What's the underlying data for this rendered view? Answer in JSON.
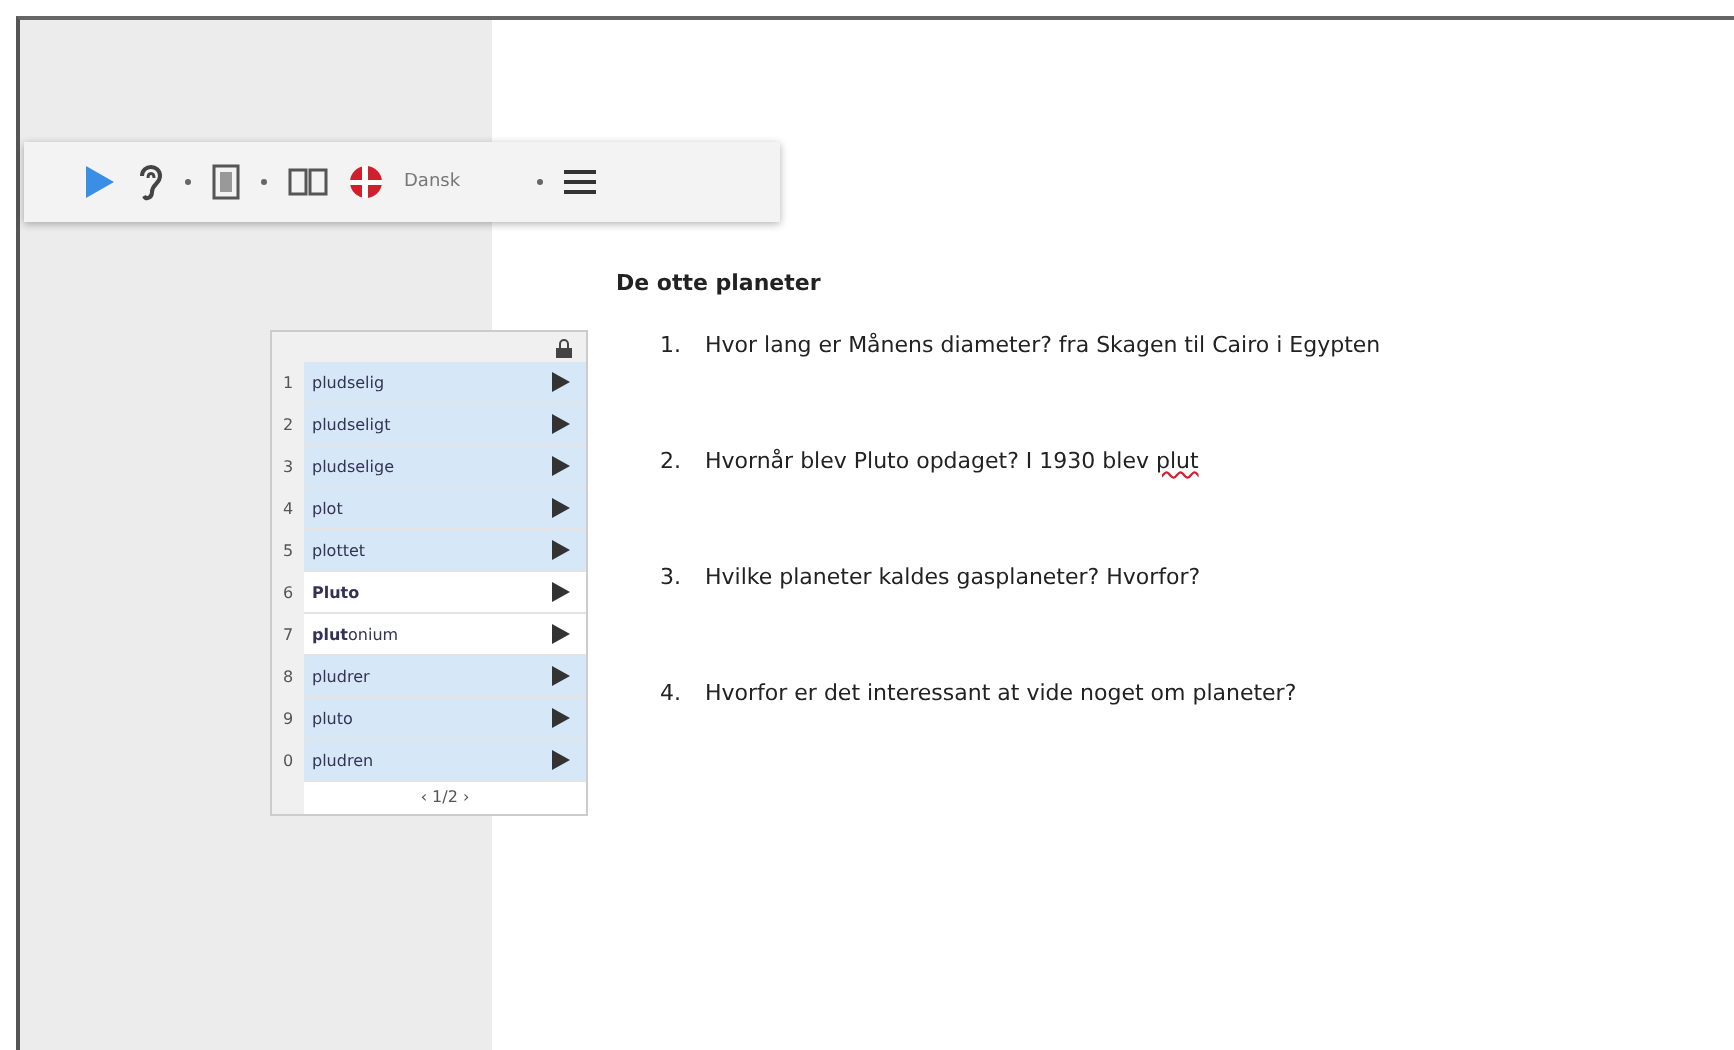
{
  "toolbar": {
    "language": "Dansk"
  },
  "word_list": {
    "items": [
      {
        "number": "1",
        "word": "pludselig",
        "shaded": true,
        "bold": false
      },
      {
        "number": "2",
        "word": "pludseligt",
        "shaded": true,
        "bold": false
      },
      {
        "number": "3",
        "word": "pludselige",
        "shaded": true,
        "bold": false
      },
      {
        "number": "4",
        "word": "plot",
        "shaded": true,
        "bold": false
      },
      {
        "number": "5",
        "word": "plottet",
        "shaded": true,
        "bold": false
      },
      {
        "number": "6",
        "word": "Pluto",
        "shaded": false,
        "bold": true
      },
      {
        "number": "7",
        "word": "**plut**onium",
        "shaded": false,
        "bold": false
      },
      {
        "number": "8",
        "word": "pludrer",
        "shaded": true,
        "bold": false
      },
      {
        "number": "9",
        "word": "pluto",
        "shaded": true,
        "bold": false
      },
      {
        "number": "0",
        "word": "pludren",
        "shaded": true,
        "bold": false
      }
    ],
    "pager": "‹ 1/2 ›"
  },
  "document": {
    "title": "De otte planeter",
    "questions": [
      {
        "number": "1.",
        "text": "Hvor lang er Månens diameter? fra Skagen til Cairo i Egypten"
      },
      {
        "number": "2.",
        "text": "Hvornår blev Pluto opdaget? I 1930 blev ",
        "misspelled": "plut"
      },
      {
        "number": "3.",
        "text": "Hvilke planeter kaldes gasplaneter? Hvorfor?"
      },
      {
        "number": "4.",
        "text": "Hvorfor er det interessant at vide noget om planeter?"
      }
    ]
  }
}
